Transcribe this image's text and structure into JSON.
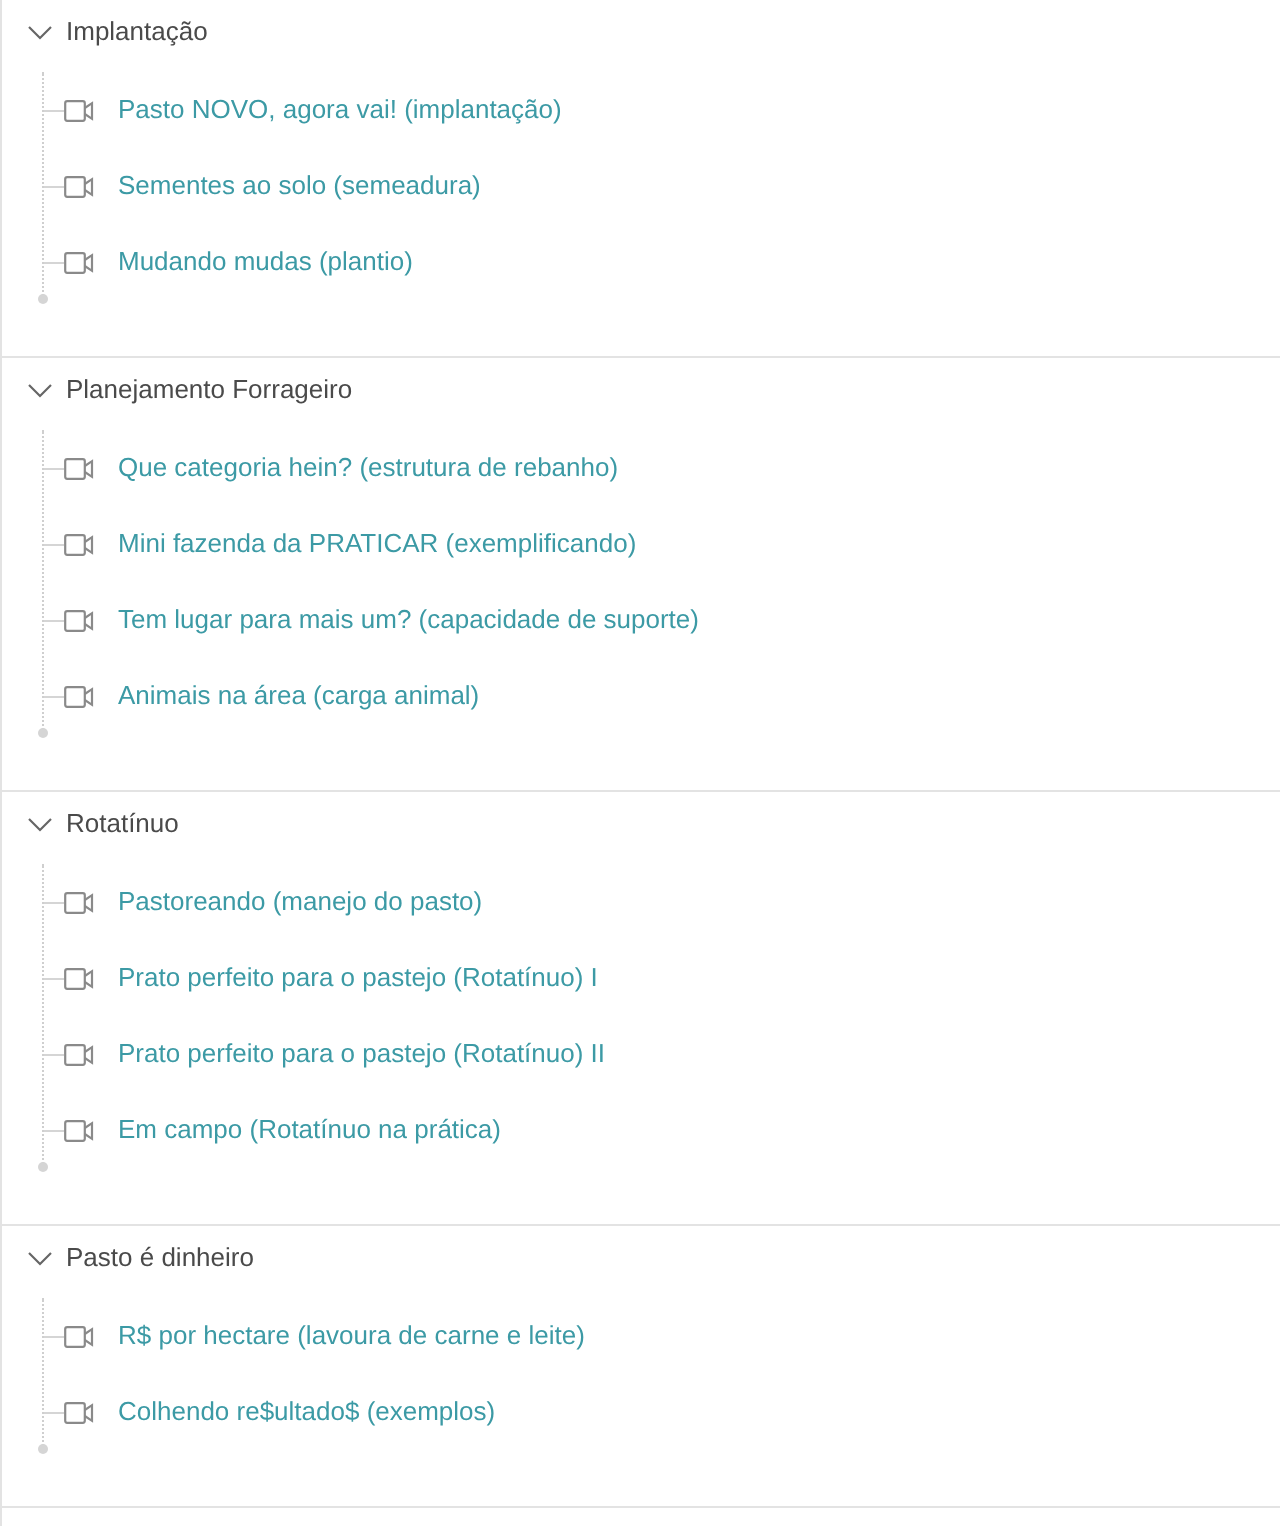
{
  "sections": [
    {
      "title": "Implantação",
      "expanded": true,
      "lessons": [
        {
          "title": "Pasto NOVO, agora vai! (implantação)"
        },
        {
          "title": "Sementes ao solo (semeadura)"
        },
        {
          "title": "Mudando mudas (plantio)"
        }
      ]
    },
    {
      "title": "Planejamento Forrageiro",
      "expanded": true,
      "lessons": [
        {
          "title": "Que categoria hein? (estrutura de rebanho)"
        },
        {
          "title": "Mini fazenda da PRATICAR (exemplificando)"
        },
        {
          "title": "Tem lugar para mais um? (capacidade de suporte)"
        },
        {
          "title": "Animais na área (carga animal)"
        }
      ]
    },
    {
      "title": "Rotatínuo",
      "expanded": true,
      "lessons": [
        {
          "title": "Pastoreando (manejo do pasto)"
        },
        {
          "title": "Prato perfeito para o pastejo (Rotatínuo) I"
        },
        {
          "title": "Prato perfeito para o pastejo (Rotatínuo) II"
        },
        {
          "title": "Em campo (Rotatínuo na prática)"
        }
      ]
    },
    {
      "title": "Pasto é dinheiro",
      "expanded": true,
      "lessons": [
        {
          "title": "R$ por hectare (lavoura de carne e leite)"
        },
        {
          "title": "Colhendo re$ultado$ (exemplos)"
        }
      ]
    }
  ]
}
